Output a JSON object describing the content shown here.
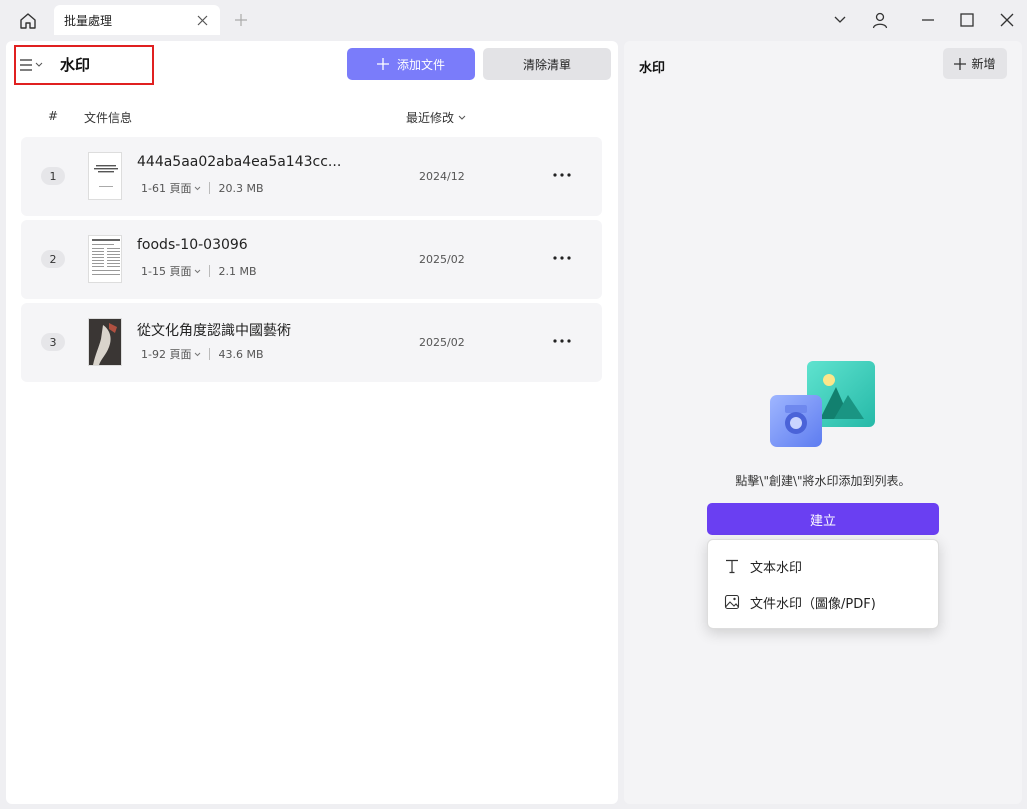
{
  "titlebar": {
    "tab_label": "批量處理"
  },
  "left": {
    "mode_title": "水印",
    "add_files_label": "添加文件",
    "clear_list_label": "清除清單",
    "columns": {
      "index": "#",
      "file_info": "文件信息",
      "modified": "最近修改"
    },
    "files": [
      {
        "index": "1",
        "name": "444a5aa02aba4ea5a143cc...",
        "pages": "1-61 頁面",
        "size": "20.3 MB",
        "date": "2024/12"
      },
      {
        "index": "2",
        "name": "foods-10-03096",
        "pages": "1-15 頁面",
        "size": "2.1 MB",
        "date": "2025/02"
      },
      {
        "index": "3",
        "name": "從文化角度認識中國藝術",
        "pages": "1-92 頁面",
        "size": "43.6 MB",
        "date": "2025/02"
      }
    ]
  },
  "right": {
    "title": "水印",
    "new_label": "新增",
    "hint": "點擊\\\"創建\\\"將水印添加到列表。",
    "create_label": "建立",
    "menu": {
      "text_watermark": "文本水印",
      "file_watermark": "文件水印（圖像/PDF)"
    }
  },
  "colors": {
    "accent": "#7a7cfa",
    "create": "#6a3ff2",
    "highlight_border": "#e02020"
  }
}
